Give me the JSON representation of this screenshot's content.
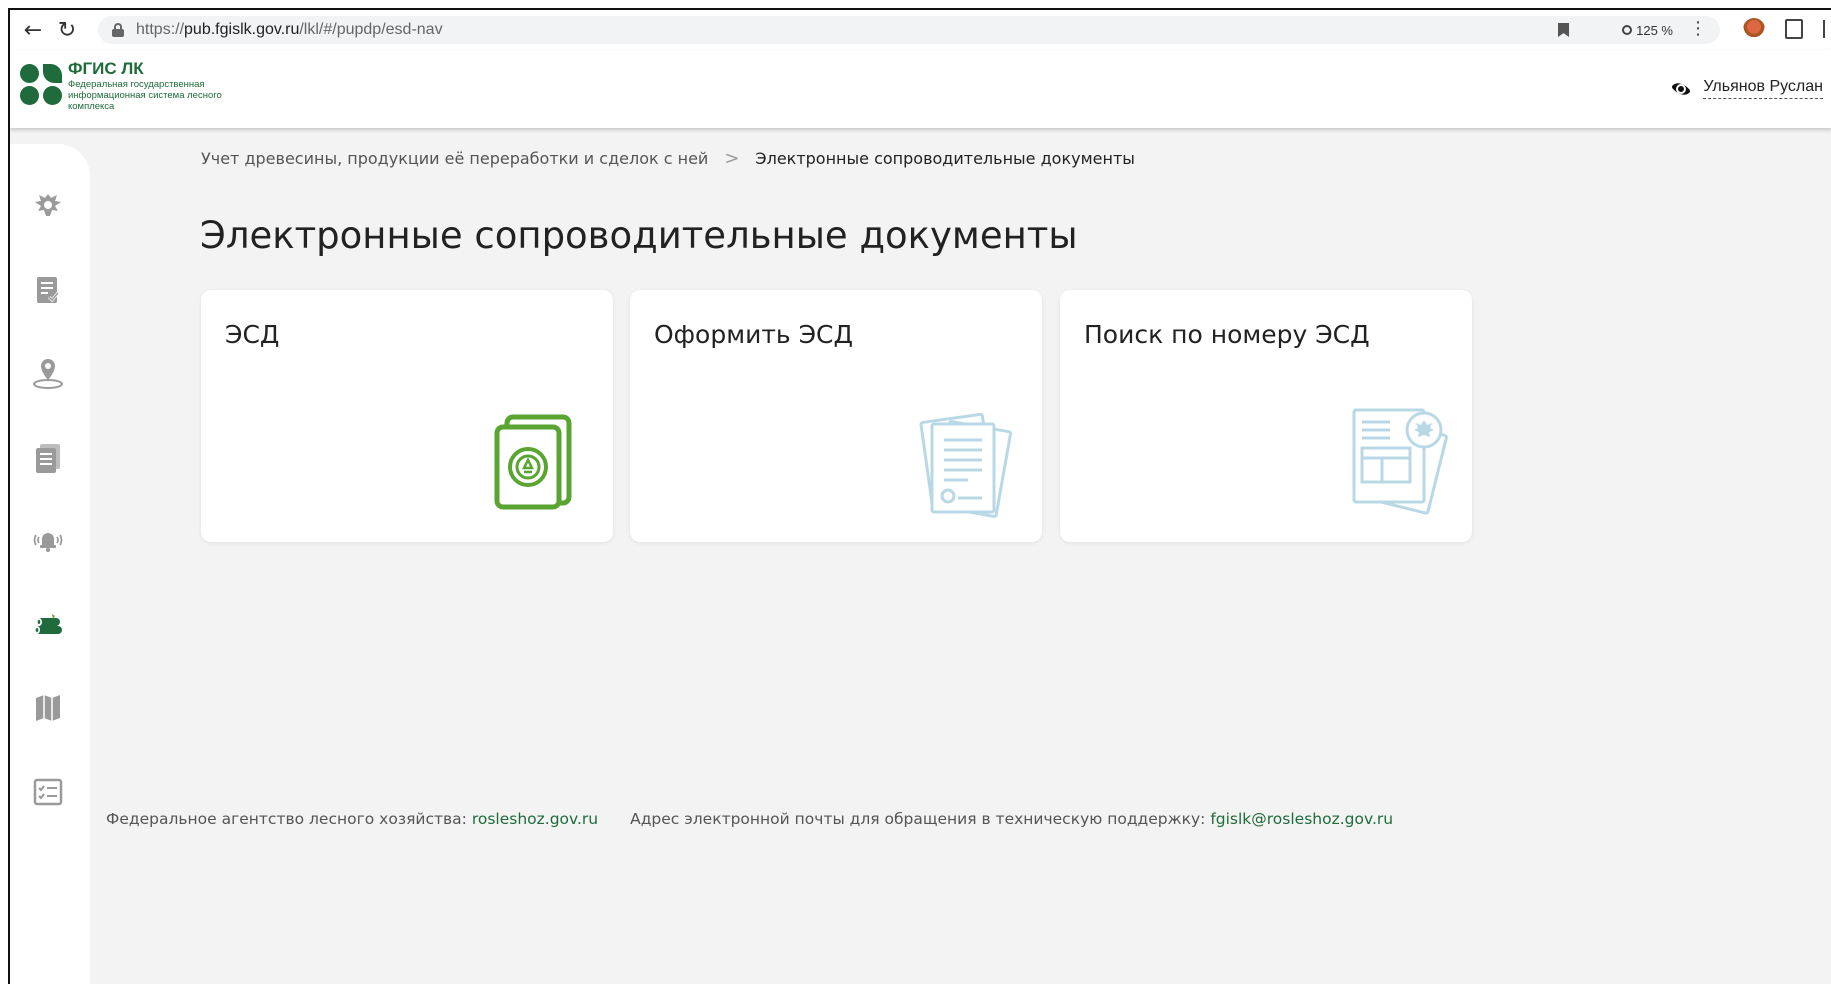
{
  "browser": {
    "url_scheme": "https://",
    "url_host": "pub.fgislk.gov.ru",
    "url_path": "/lkl/#/pupdp/esd-nav",
    "zoom": "125 %"
  },
  "header": {
    "brand_title": "ФГИС ЛК",
    "brand_subtitle": "Федеральная государственная информационная система лесного комплекса",
    "user_name": "Ульянов Руслан"
  },
  "sidebar": {
    "items": [
      {
        "icon": "emblem-icon"
      },
      {
        "icon": "document-check-icon"
      },
      {
        "icon": "location-pin-icon"
      },
      {
        "icon": "documents-stack-icon"
      },
      {
        "icon": "bell-alert-icon"
      },
      {
        "icon": "timber-logs-icon",
        "active": true
      },
      {
        "icon": "map-icon"
      },
      {
        "icon": "checklist-icon"
      }
    ]
  },
  "breadcrumb": {
    "parent": "Учет древесины, продукции её переработки и сделок с ней",
    "separator": ">",
    "current": "Электронные сопроводительные документы"
  },
  "main": {
    "title": "Электронные сопроводительные документы",
    "cards": [
      {
        "title": "ЭСД",
        "icon": "esd-certificate-icon"
      },
      {
        "title": "Оформить ЭСД",
        "icon": "document-pages-icon"
      },
      {
        "title": "Поиск по номеру ЭСД",
        "icon": "document-emblem-icon"
      }
    ]
  },
  "footer": {
    "agency_label": "Федеральное агентство лесного хозяйства:",
    "agency_link": "rosleshoz.gov.ru",
    "support_label": "Адрес электронной почты для обращения в техническую поддержку:",
    "support_link": "fgislk@rosleshoz.gov.ru"
  },
  "colors": {
    "brand_green": "#1f6b3c",
    "card_icon_green": "#5aa431",
    "card_icon_light_blue": "#b9d8e6",
    "sidebar_icon_gray": "#9a9a9a"
  }
}
